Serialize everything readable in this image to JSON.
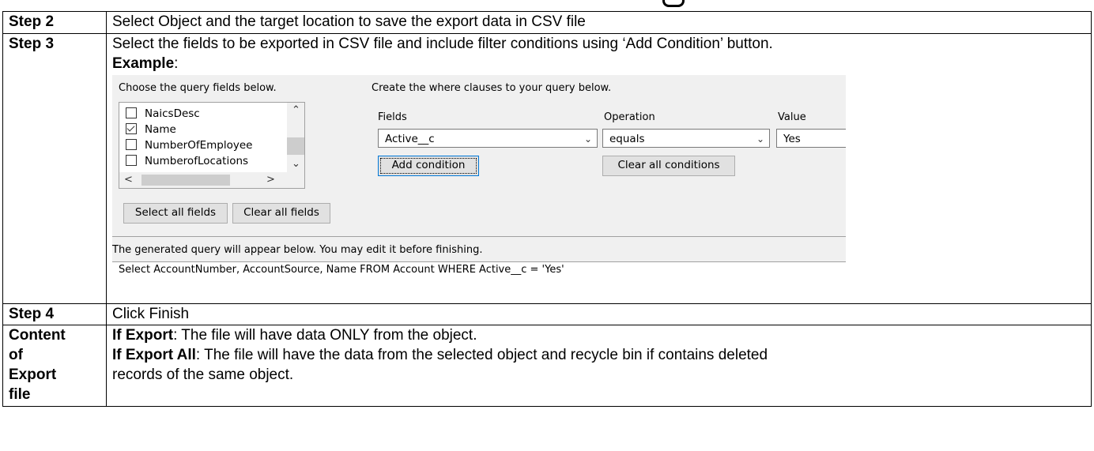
{
  "rows": [
    {
      "label": "Step 2",
      "text": "Select Object and the target location to save the export data in CSV file"
    },
    {
      "label": "Step 3",
      "text": "Select the fields to be exported in CSV file and include filter conditions using ‘Add Condition’ button.",
      "example_label": "Example",
      "example_colon": ":"
    },
    {
      "label": "Step 4",
      "text": "Click Finish"
    },
    {
      "label_lines": [
        "Content",
        "of",
        "Export",
        "file"
      ],
      "line1_bold": "If Export",
      "line1_rest": ": The file will have data ONLY from the object.",
      "line2_bold": "If Export All",
      "line2_rest": ": The file will have the data from the selected object and recycle bin if contains deleted",
      "line3": "records of the same object."
    }
  ],
  "dialog": {
    "choose_label": "Choose the query fields below.",
    "where_label": "Create the where clauses to your query below.",
    "fields": [
      {
        "name": "NaicsDesc",
        "checked": false
      },
      {
        "name": "Name",
        "checked": true
      },
      {
        "name": "NumberOfEmployee",
        "checked": false
      },
      {
        "name": "NumberofLocations",
        "checked": false
      }
    ],
    "col_fields": "Fields",
    "col_operation": "Operation",
    "col_value": "Value",
    "field_value": "Active__c",
    "operation_value": "equals",
    "value_value": "Yes",
    "add_condition": "Add condition",
    "clear_conditions": "Clear all conditions",
    "select_all": "Select all fields",
    "clear_all": "Clear all fields",
    "generated_note": "The generated query will appear below.  You may edit it before finishing.",
    "query": "Select AccountNumber, AccountSource, Name FROM Account WHERE Active__c = 'Yes'"
  },
  "icons": {
    "scroll_up": "▲-icon",
    "scroll_down": "▼-icon"
  }
}
